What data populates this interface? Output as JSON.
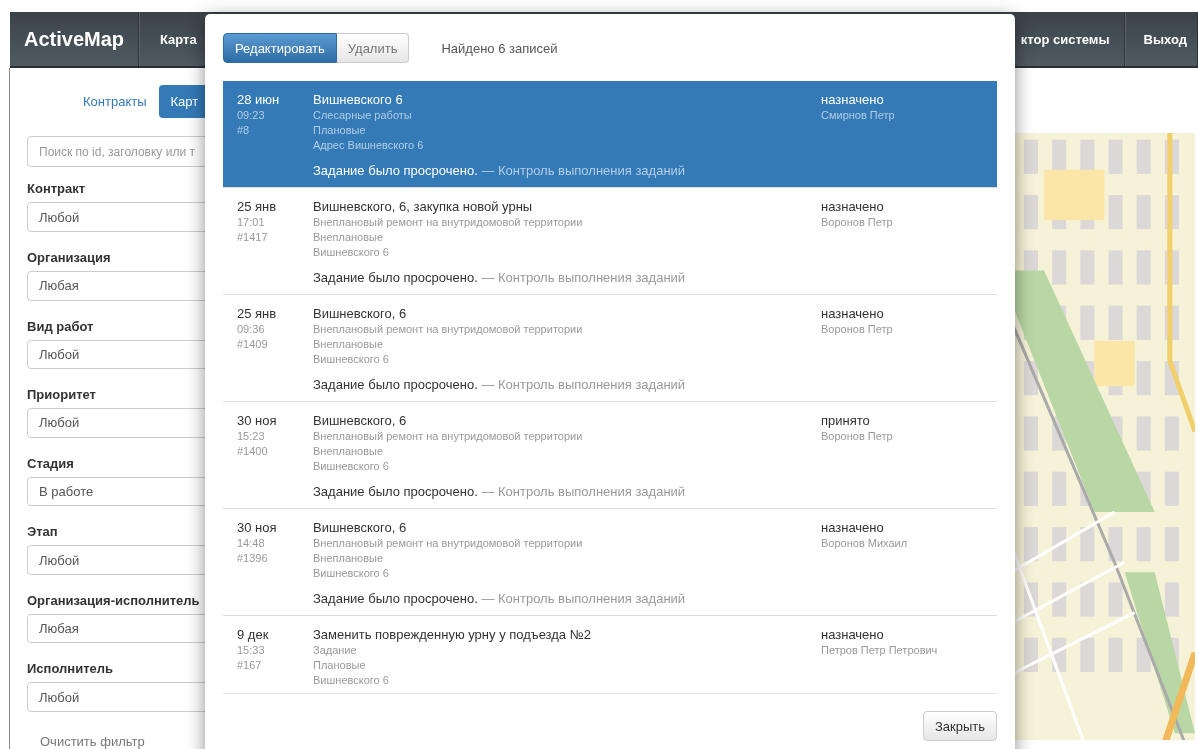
{
  "navbar": {
    "logo": "ActiveMap",
    "items": [
      {
        "label": "Карта"
      },
      {
        "label": "ктор системы"
      },
      {
        "label": "Выход"
      }
    ]
  },
  "sidebar": {
    "tabs": [
      {
        "label": "Контракты",
        "selected": false
      },
      {
        "label": "Карт",
        "selected": true
      }
    ],
    "search": {
      "placeholder": "Поиск по id, заголовку или т"
    },
    "filters": [
      {
        "label": "Контракт",
        "value": "Любой"
      },
      {
        "label": "Организация",
        "value": "Любая"
      },
      {
        "label": "Вид работ",
        "value": "Любой"
      },
      {
        "label": "Приоритет",
        "value": "Любой"
      },
      {
        "label": "Стадия",
        "value": "В работе"
      },
      {
        "label": "Этап",
        "value": "Любой"
      },
      {
        "label": "Организация-исполнитель",
        "value": "Любая"
      },
      {
        "label": "Исполнитель",
        "value": "Любой"
      }
    ],
    "clear_link": "Очистить фильтр"
  },
  "modal": {
    "buttons": [
      {
        "label": "Редактировать",
        "selected": true
      },
      {
        "label": "Удалить",
        "selected": false
      }
    ],
    "count": "Найдено 6 записей",
    "rows": [
      {
        "selected": true,
        "date": "28 июн",
        "time": "09:23",
        "id": "#8",
        "title": "Вишневского 6",
        "details": [
          "Слесарные работы",
          "Плановые",
          "Адрес Вишневского 6"
        ],
        "status": "назначено",
        "person": "Смирнов Петр",
        "note": "Задание было просрочено.",
        "note_source": "— Контроль выполнения заданий"
      },
      {
        "selected": false,
        "date": "25 янв",
        "time": "17:01",
        "id": "#1417",
        "title": "Вишневского, 6, закупка новой урны",
        "details": [
          "Внеплановый ремонт на внутридомовой территории",
          "Внеплановые",
          "Вишневского 6"
        ],
        "status": "назначено",
        "person": "Воронов Петр",
        "note": "Задание было просрочено.",
        "note_source": "— Контроль выполнения заданий"
      },
      {
        "selected": false,
        "date": "25 янв",
        "time": "09:36",
        "id": "#1409",
        "title": "Вишневского, 6",
        "details": [
          "Внеплановый ремонт на внутридомовой территории",
          "Внеплановые",
          "Вишневского 6"
        ],
        "status": "назначено",
        "person": "Воронов Петр",
        "note": "Задание было просрочено.",
        "note_source": "— Контроль выполнения заданий"
      },
      {
        "selected": false,
        "date": "30 ноя",
        "time": "15:23",
        "id": "#1400",
        "title": "Вишневского, 6",
        "details": [
          "Внеплановый ремонт на внутридомовой территории",
          "Внеплановые",
          "Вишневского 6"
        ],
        "status": "принято",
        "person": "Воронов Петр",
        "note": "Задание было просрочено.",
        "note_source": "— Контроль выполнения заданий"
      },
      {
        "selected": false,
        "date": "30 ноя",
        "time": "14:48",
        "id": "#1396",
        "title": "Вишневского, 6",
        "details": [
          "Внеплановый ремонт на внутридомовой территории",
          "Внеплановые",
          "Вишневского 6"
        ],
        "status": "назначено",
        "person": "Воронов Михаил",
        "note": "Задание было просрочено.",
        "note_source": "— Контроль выполнения заданий"
      },
      {
        "selected": false,
        "date": "9 дек",
        "time": "15:33",
        "id": "#167",
        "title": "Заменить поврежденную урну у подъезда №2",
        "details": [
          "Задание",
          "Плановые",
          "Вишневского 6"
        ],
        "status": "назначено",
        "person": "Петров Петр Петрович"
      }
    ],
    "close_button": "Закрыть"
  }
}
